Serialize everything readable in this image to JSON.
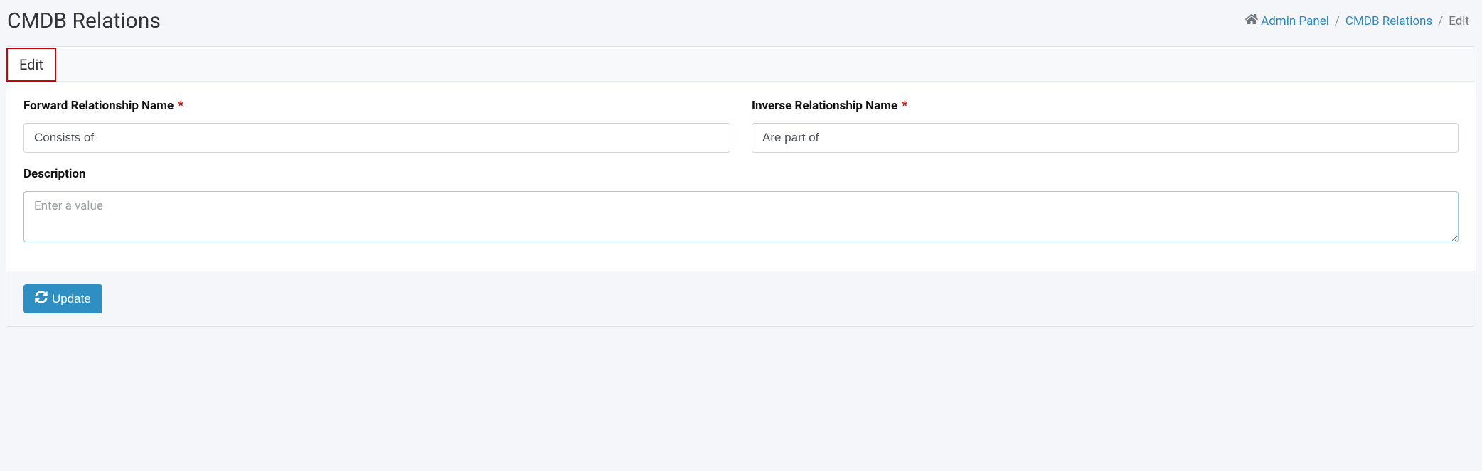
{
  "header": {
    "title": "CMDB Relations"
  },
  "breadcrumb": {
    "admin_panel": "Admin Panel",
    "cmdb_relations": "CMDB Relations",
    "edit": "Edit"
  },
  "tab": {
    "label": "Edit"
  },
  "form": {
    "forward_label": "Forward Relationship Name",
    "forward_value": "Consists of",
    "inverse_label": "Inverse Relationship Name",
    "inverse_value": "Are part of",
    "description_label": "Description",
    "description_value": "",
    "description_placeholder": "Enter a value",
    "required_mark": "*"
  },
  "actions": {
    "update_label": "Update"
  }
}
